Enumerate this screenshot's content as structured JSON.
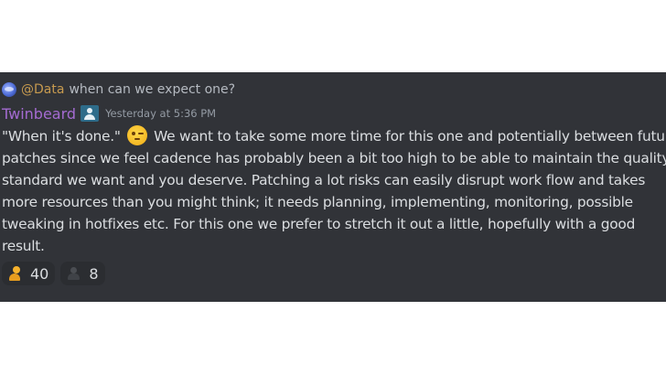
{
  "reply": {
    "avatar_icon": "bot-avatar-icon",
    "mention": "@Data",
    "text": "when can we expect one?"
  },
  "message": {
    "author": "Twinbeard",
    "role_icon": "user-role-icon",
    "timestamp": "Yesterday at 5:36 PM",
    "lines": [
      "\"When it's done.\"",
      "We want to take some more time for this one and potentially between future",
      "patches since we feel cadence has probably been a bit too high to be able to maintain the quality",
      "standard we want and you deserve. Patching a lot risks can easily disrupt work flow and takes",
      "more resources than you might think; it needs planning, implementing, monitoring, possible",
      "tweaking in hotfixes etc. For this one we prefer to stretch it out a little, hopefully with a good",
      "result."
    ],
    "inline_emoji": "wink-emoji-icon"
  },
  "reactions": [
    {
      "icon": "person-emoji-icon",
      "count": "40"
    },
    {
      "icon": "dark-person-emoji-icon",
      "count": "8"
    }
  ],
  "colors": {
    "background": "#313338",
    "author": "#a46bd1",
    "mention": "#c69a4f",
    "text": "#dbdee1",
    "muted": "#949ba4",
    "reaction_bg": "#2b2d31"
  }
}
